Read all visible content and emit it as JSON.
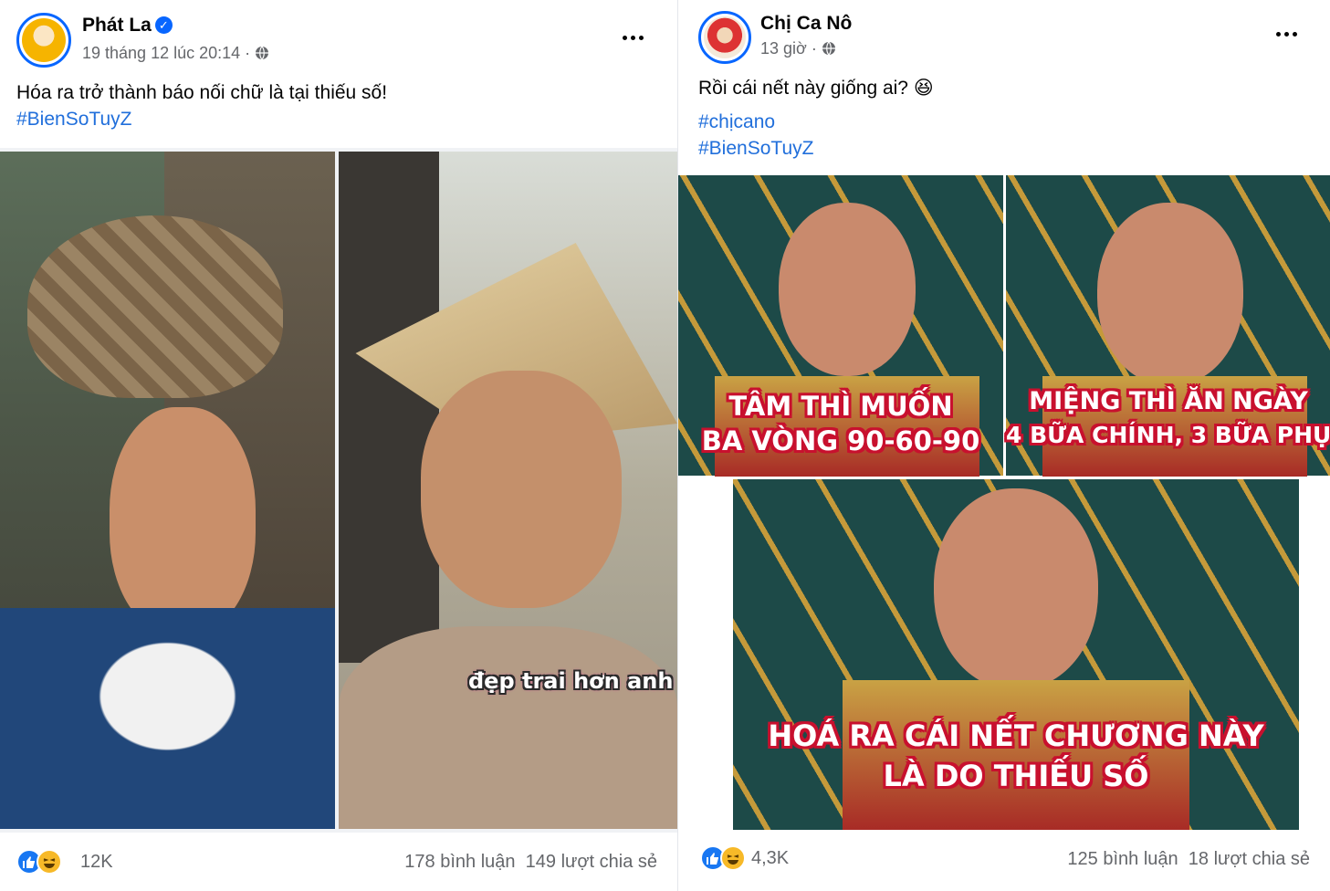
{
  "posts": [
    {
      "author": "Phát La",
      "verified": true,
      "timestamp": "19 tháng 12 lúc 20:14",
      "audience_icon": "globe-icon",
      "text": "Hóa ra trở thành báo nối chữ là tại thiếu số!",
      "hashtags": [
        "#BienSoTuyZ"
      ],
      "media_caption": "đẹp trai hơn anh",
      "reactions": [
        "like-icon",
        "haha-icon"
      ],
      "reaction_count": "12K",
      "comments": "178 bình luận",
      "shares": "149 lượt chia sẻ"
    },
    {
      "author": "Chị Ca Nô",
      "verified": false,
      "timestamp": "13 giờ",
      "audience_icon": "globe-icon",
      "text": "Rồi cái nết này giống ai?",
      "emoji": "😆",
      "hashtags": [
        "#chịcano",
        "#BienSoTuyZ"
      ],
      "meme_panels": [
        {
          "line1": "TÂM THÌ MUỐN",
          "line2": "BA VÒNG 90-60-90"
        },
        {
          "line1": "MIỆNG THÌ ĂN NGÀY",
          "line2": "4 BỮA CHÍNH, 3 BỮA PHỤ"
        },
        {
          "line1": "HOÁ RA CÁI NẾT CHƯƠNG NÀY",
          "line2": "LÀ DO THIẾU SỐ"
        }
      ],
      "reactions": [
        "like-icon",
        "haha-icon"
      ],
      "reaction_count": "4,3K",
      "comments": "125 bình luận",
      "shares": "18 lượt chia sẻ"
    }
  ],
  "colors": {
    "link": "#216fdb",
    "meta": "#65676b",
    "verified": "#0866ff",
    "caption_outline": "#c8102e"
  }
}
